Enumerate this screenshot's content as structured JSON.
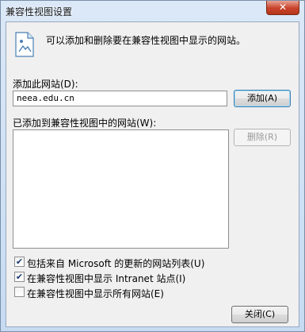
{
  "window": {
    "title": "兼容性视图设置",
    "close_glyph": "✕"
  },
  "info": {
    "text": "可以添加和删除要在兼容性视图中显示的网站。",
    "icon": "website-list-icon"
  },
  "add_site": {
    "label": "添加此网站(D):",
    "value": "neea.edu.cn",
    "button": "添加(A)"
  },
  "site_list": {
    "label": "已添加到兼容性视图中的网站(W):",
    "items": [],
    "remove_button": "删除(R)"
  },
  "options": [
    {
      "label": "包括来自 Microsoft 的更新的网站列表(U)",
      "checked": true
    },
    {
      "label": "在兼容性视图中显示 Intranet 站点(I)",
      "checked": true
    },
    {
      "label": "在兼容性视图中显示所有网站(E)",
      "checked": false
    }
  ],
  "check_glyph": "✔",
  "close_button": "关闭(C)"
}
